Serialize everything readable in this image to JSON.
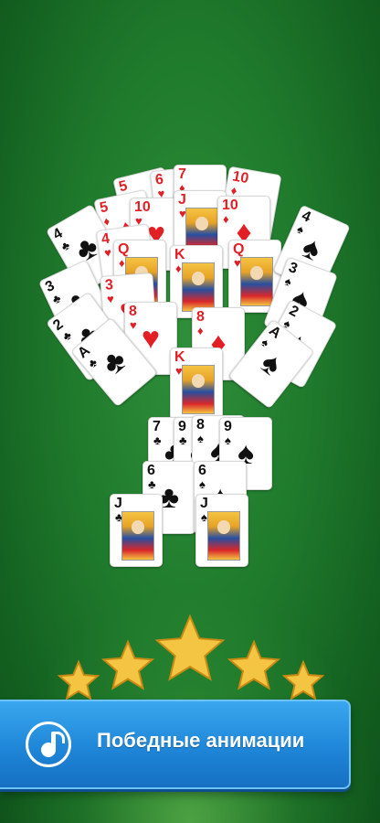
{
  "banner": {
    "text": "Победные анимации",
    "icon": "music-note-icon"
  },
  "trophy_cards": [
    {
      "rank": "5",
      "suit": "♥",
      "color": "red",
      "face": false
    },
    {
      "rank": "6",
      "suit": "♥",
      "color": "red",
      "face": false
    },
    {
      "rank": "7",
      "suit": "♦",
      "color": "red",
      "face": false
    },
    {
      "rank": "10",
      "suit": "♦",
      "color": "red",
      "face": false
    },
    {
      "rank": "5",
      "suit": "♦",
      "color": "red",
      "face": false
    },
    {
      "rank": "10",
      "suit": "♥",
      "color": "red",
      "face": false
    },
    {
      "rank": "J",
      "suit": "♥",
      "color": "red",
      "face": true
    },
    {
      "rank": "10",
      "suit": "♦",
      "color": "red",
      "face": false
    },
    {
      "rank": "4",
      "suit": "♣",
      "color": "black",
      "face": false
    },
    {
      "rank": "4",
      "suit": "♥",
      "color": "red",
      "face": false
    },
    {
      "rank": "Q",
      "suit": "♦",
      "color": "red",
      "face": true
    },
    {
      "rank": "K",
      "suit": "♦",
      "color": "red",
      "face": true
    },
    {
      "rank": "Q",
      "suit": "♥",
      "color": "red",
      "face": true
    },
    {
      "rank": "4",
      "suit": "♠",
      "color": "black",
      "face": false
    },
    {
      "rank": "3",
      "suit": "♣",
      "color": "black",
      "face": false
    },
    {
      "rank": "3",
      "suit": "♥",
      "color": "red",
      "face": false
    },
    {
      "rank": "3",
      "suit": "♠",
      "color": "black",
      "face": false
    },
    {
      "rank": "2",
      "suit": "♣",
      "color": "black",
      "face": false
    },
    {
      "rank": "2",
      "suit": "♠",
      "color": "black",
      "face": false
    },
    {
      "rank": "8",
      "suit": "♥",
      "color": "red",
      "face": false
    },
    {
      "rank": "8",
      "suit": "♦",
      "color": "red",
      "face": false
    },
    {
      "rank": "A",
      "suit": "♣",
      "color": "black",
      "face": false
    },
    {
      "rank": "A",
      "suit": "♠",
      "color": "black",
      "face": false
    },
    {
      "rank": "K",
      "suit": "♥",
      "color": "red",
      "face": true
    },
    {
      "rank": "7",
      "suit": "♣",
      "color": "black",
      "face": false
    },
    {
      "rank": "9",
      "suit": "♣",
      "color": "black",
      "face": false
    },
    {
      "rank": "8",
      "suit": "♠",
      "color": "black",
      "face": false
    },
    {
      "rank": "9",
      "suit": "♠",
      "color": "black",
      "face": false
    },
    {
      "rank": "6",
      "suit": "♣",
      "color": "black",
      "face": false
    },
    {
      "rank": "6",
      "suit": "♠",
      "color": "black",
      "face": false
    },
    {
      "rank": "J",
      "suit": "♣",
      "color": "black",
      "face": true
    },
    {
      "rank": "J",
      "suit": "♠",
      "color": "black",
      "face": true
    }
  ],
  "colors": {
    "felt": "#1f7a2c",
    "banner": "#1f86d8",
    "star": "#f4c542"
  }
}
